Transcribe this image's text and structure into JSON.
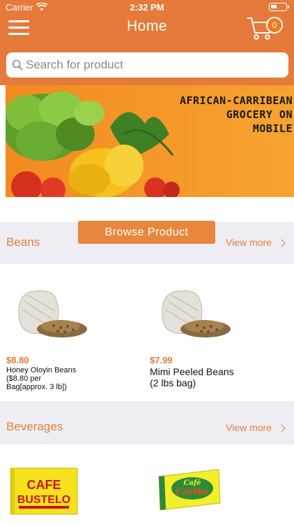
{
  "status_bar": {
    "carrier": "Carrier",
    "time": "2:32 PM"
  },
  "header": {
    "title": "Home",
    "cart_count": "0"
  },
  "search": {
    "placeholder": "Search for product"
  },
  "banner": {
    "line1": "AFRICAN-CARRIBEAN",
    "line2": "GROCERY ON",
    "line3": "MOBILE"
  },
  "browse_button": {
    "label": "Browse Product"
  },
  "sections": [
    {
      "title": "Beans",
      "view_more": "View more",
      "products": [
        {
          "price": "$8.80",
          "name": "Honey Oloyin Beans ($8.80 per Bag[approx. 3 lb])"
        },
        {
          "price": "$7.99",
          "name": "Mimi Peeled Beans (2 lbs bag)"
        }
      ]
    },
    {
      "title": "Beverages",
      "view_more": "View more",
      "products": [
        {
          "logo_text": [
            "CAFE",
            "BUSTELO"
          ]
        },
        {
          "logo_text": [
            "Café",
            "Caribe"
          ]
        }
      ]
    }
  ],
  "colors": {
    "brand": "#e57a3a",
    "section_bg": "#eeedf3",
    "accent_text": "#e2823d"
  }
}
